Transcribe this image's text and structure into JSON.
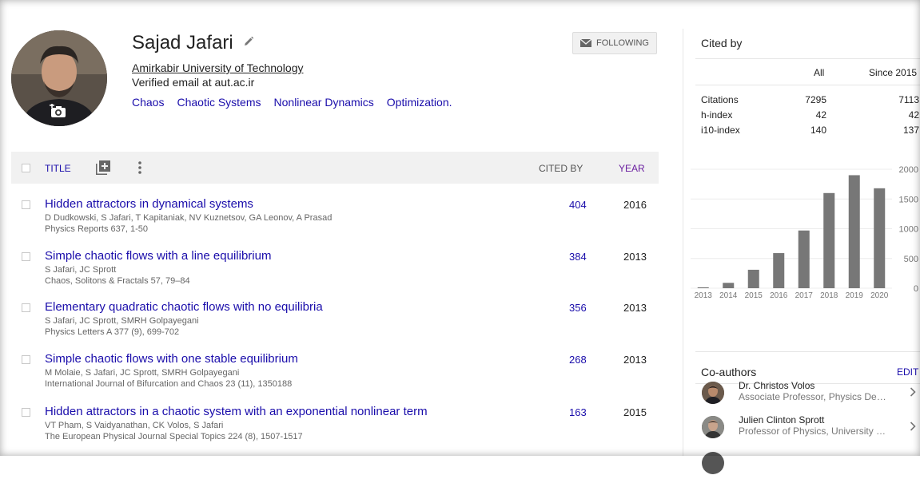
{
  "profile": {
    "name": "Sajad Jafari",
    "affiliation": "Amirkabir University of Technology",
    "email": "Verified email at aut.ac.ir",
    "interests": [
      "Chaos",
      "Chaotic Systems",
      "Nonlinear Dynamics",
      "Optimization."
    ],
    "follow_label": "FOLLOWING"
  },
  "table": {
    "headers": {
      "title": "TITLE",
      "cited_by": "CITED BY",
      "year": "YEAR"
    },
    "rows": [
      {
        "title": "Hidden attractors in dynamical systems",
        "authors": "D Dudkowski, S Jafari, T Kapitaniak, NV Kuznetsov, GA Leonov, A Prasad",
        "venue": "Physics Reports 637, 1-50",
        "cited": "404",
        "year": "2016"
      },
      {
        "title": "Simple chaotic flows with a line equilibrium",
        "authors": "S Jafari, JC Sprott",
        "venue": "Chaos, Solitons & Fractals 57, 79–84",
        "cited": "384",
        "year": "2013"
      },
      {
        "title": "Elementary quadratic chaotic flows with no equilibria",
        "authors": "S Jafari, JC Sprott, SMRH Golpayegani",
        "venue": "Physics Letters A 377 (9), 699-702",
        "cited": "356",
        "year": "2013"
      },
      {
        "title": "Simple chaotic flows with one stable equilibrium",
        "authors": "M Molaie, S Jafari, JC Sprott, SMRH Golpayegani",
        "venue": "International Journal of Bifurcation and Chaos 23 (11), 1350188",
        "cited": "268",
        "year": "2013"
      },
      {
        "title": "Hidden attractors in a chaotic system with an exponential nonlinear term",
        "authors": "VT Pham, S Vaidyanathan, CK Volos, S Jafari",
        "venue": "The European Physical Journal Special Topics 224 (8), 1507-1517",
        "cited": "163",
        "year": "2015"
      }
    ]
  },
  "cited_by": {
    "title": "Cited by",
    "columns": [
      "All",
      "Since 2015"
    ],
    "rows": [
      {
        "label": "Citations",
        "all": "7295",
        "since": "7113"
      },
      {
        "label": "h-index",
        "all": "42",
        "since": "42"
      },
      {
        "label": "i10-index",
        "all": "140",
        "since": "137"
      }
    ]
  },
  "chart_data": {
    "type": "bar",
    "categories": [
      "2013",
      "2014",
      "2015",
      "2016",
      "2017",
      "2018",
      "2019",
      "2020"
    ],
    "values": [
      15,
      90,
      310,
      590,
      970,
      1600,
      1900,
      1680
    ],
    "yticks": [
      "2000",
      "1500",
      "1000",
      "500",
      "0"
    ],
    "ylim": [
      0,
      2000
    ],
    "bar_color": "#777777",
    "grid": true
  },
  "coauthors": {
    "title": "Co-authors",
    "edit_label": "EDIT",
    "items": [
      {
        "name": "Dr. Christos Volos",
        "affiliation": "Associate Professor, Physics De…"
      },
      {
        "name": "Julien Clinton Sprott",
        "affiliation": "Professor of Physics, University …"
      }
    ]
  },
  "colors": {
    "link": "#1a0dab",
    "year_header": "#6b1fa0",
    "header_bg": "#f1f1f1"
  }
}
